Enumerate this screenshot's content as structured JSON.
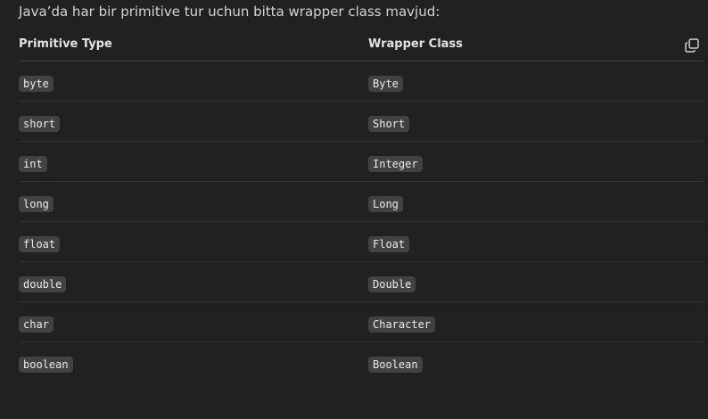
{
  "intro_text": "Java’da har bir primitive tur uchun bitta wrapper class mavjud:",
  "table": {
    "headers": {
      "primitive": "Primitive Type",
      "wrapper": "Wrapper Class"
    },
    "copy_icon": "copy-icon",
    "rows": [
      {
        "primitive": "byte",
        "wrapper": "Byte"
      },
      {
        "primitive": "short",
        "wrapper": "Short"
      },
      {
        "primitive": "int",
        "wrapper": "Integer"
      },
      {
        "primitive": "long",
        "wrapper": "Long"
      },
      {
        "primitive": "float",
        "wrapper": "Float"
      },
      {
        "primitive": "double",
        "wrapper": "Double"
      },
      {
        "primitive": "char",
        "wrapper": "Character"
      },
      {
        "primitive": "boolean",
        "wrapper": "Boolean"
      }
    ]
  },
  "colors": {
    "background": "#212121",
    "code_bg": "#424242",
    "text": "#ececec"
  }
}
